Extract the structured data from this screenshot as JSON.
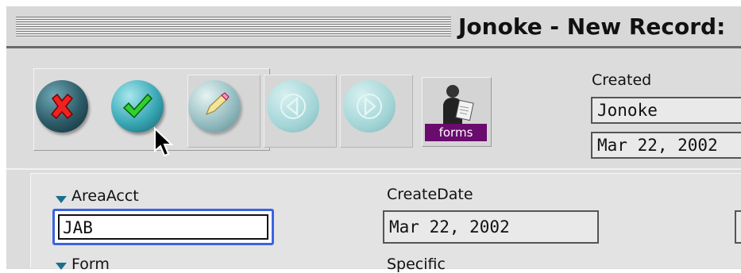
{
  "window": {
    "title": "Jonoke - New Record:"
  },
  "toolbar": {
    "buttons": [
      {
        "name": "cancel",
        "icon": "x-icon"
      },
      {
        "name": "ok",
        "icon": "checkmark-icon"
      },
      {
        "name": "edit",
        "icon": "pencil-icon"
      },
      {
        "name": "previous",
        "icon": "left-arrow-icon"
      },
      {
        "name": "next",
        "icon": "right-arrow-icon"
      }
    ],
    "forms_label": "forms"
  },
  "created": {
    "label": "Created",
    "user": "Jonoke",
    "date": "Mar 22, 2002"
  },
  "form": {
    "area_acct_label": "AreaAcct",
    "area_acct_value": "JAB",
    "create_date_label": "CreateDate",
    "create_date_value": "Mar 22, 2002",
    "form_label": "Form",
    "specific_label": "Specific"
  },
  "colors": {
    "focus_ring": "#3b62e0",
    "forms_label_bg": "#6a0b6e",
    "triangle": "#1b6f8d"
  }
}
